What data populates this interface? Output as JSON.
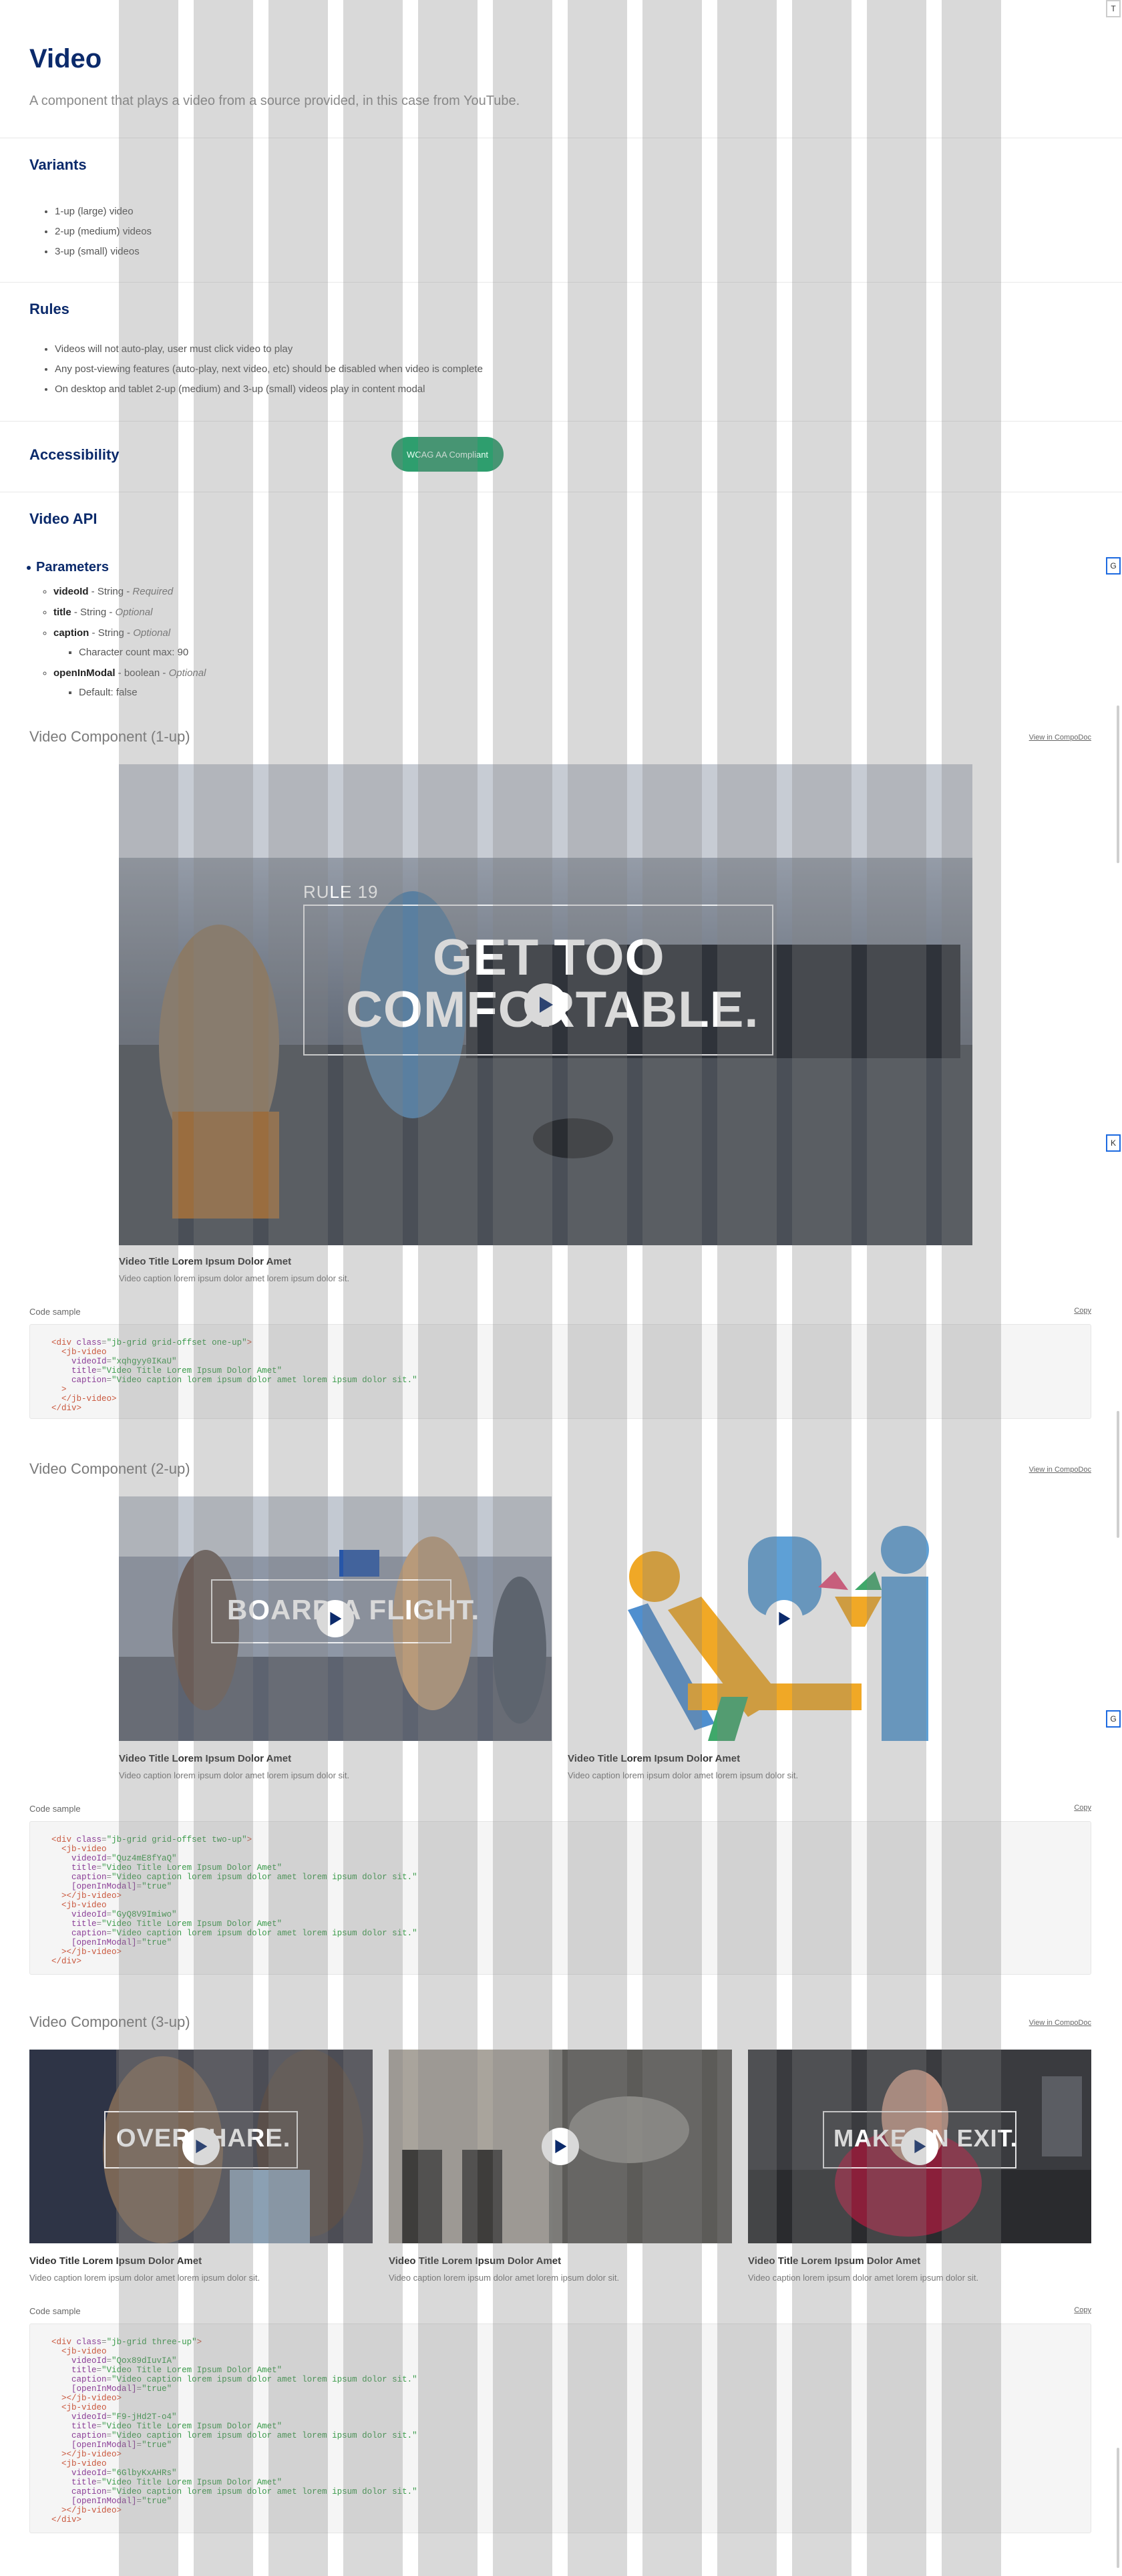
{
  "header": {
    "title": "Video",
    "lead": "A component that plays a video from a source provided, in this case from YouTube."
  },
  "variants": {
    "title": "Variants",
    "items": [
      "1-up (large) video",
      "2-up (medium) videos",
      "3-up (small) videos"
    ]
  },
  "rules": {
    "title": "Rules",
    "items": [
      "Videos will not auto-play, user must click video to play",
      "Any post-viewing features (auto-play, next video, etc) should be disabled when video is complete",
      "On desktop and tablet 2-up (medium) and 3-up (small) videos play in content modal"
    ]
  },
  "accessibility": {
    "title": "Accessibility",
    "badge": "WCAG AA Compliant"
  },
  "api": {
    "title": "Video API",
    "params_title": "Parameters",
    "params": [
      {
        "name": "videoId",
        "type": "String",
        "req": "Required",
        "sub": []
      },
      {
        "name": "title",
        "type": "String",
        "req": "Optional",
        "sub": []
      },
      {
        "name": "caption",
        "type": "String",
        "req": "Optional",
        "sub": [
          "Character count max: 90"
        ]
      },
      {
        "name": "openInModal",
        "type": "boolean",
        "req": "Optional",
        "sub": [
          "Default: false"
        ]
      }
    ]
  },
  "sections": {
    "one": {
      "title": "Video Component (1-up)",
      "link": "View in CompoDoc",
      "code_label": "Code sample",
      "copy": "Copy",
      "video": {
        "title": "Video Title Lorem Ipsum Dolor Amet",
        "caption": "Video caption lorem ipsum dolor amet lorem ipsum dolor sit.",
        "overlay_small": "RULE 19",
        "overlay_line1": "GET TOO",
        "overlay_line2": "COMFORTABLE."
      }
    },
    "two": {
      "title": "Video Component (2-up)",
      "link": "View in CompoDoc",
      "code_label": "Code sample",
      "copy": "Copy",
      "videos": [
        {
          "title": "Video Title Lorem Ipsum Dolor Amet",
          "caption": "Video caption lorem ipsum dolor amet lorem ipsum dolor sit.",
          "overlay": "BOARD A FLIGHT."
        },
        {
          "title": "Video Title Lorem Ipsum Dolor Amet",
          "caption": "Video caption lorem ipsum dolor amet lorem ipsum dolor sit."
        }
      ]
    },
    "three": {
      "title": "Video Component (3-up)",
      "link": "View in CompoDoc",
      "code_label": "Code sample",
      "copy": "Copy",
      "videos": [
        {
          "title": "Video Title Lorem Ipsum Dolor Amet",
          "caption": "Video caption lorem ipsum dolor amet lorem ipsum dolor sit.",
          "overlay": "OVERSHARE."
        },
        {
          "title": "Video Title Lorem Ipsum Dolor Amet",
          "caption": "Video caption lorem ipsum dolor amet lorem ipsum dolor sit."
        },
        {
          "title": "Video Title Lorem Ipsum Dolor Amet",
          "caption": "Video caption lorem ipsum dolor amet lorem ipsum dolor sit.",
          "overlay": "MAKE AN EXIT."
        }
      ]
    }
  },
  "edge_tabs": [
    "T",
    "G",
    "K",
    "G"
  ],
  "colors": {
    "navy": "#0b2a6b",
    "badge_green": "#2e9e6e",
    "code_tag": "#c9573d",
    "code_attr": "#8a3d96",
    "code_str": "#3a9b4a",
    "play_icon": "#0b2a6b"
  }
}
